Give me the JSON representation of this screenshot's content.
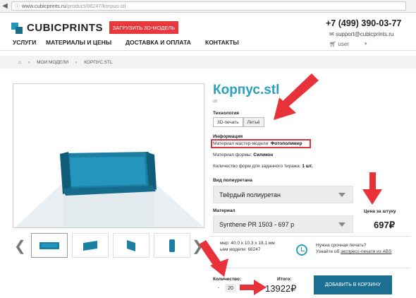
{
  "browser": {
    "url_host": "www.cubicprints.ru",
    "url_path": "/product/68247/korpus-stl"
  },
  "header": {
    "logo_text": "CUBICPRINTS",
    "upload_button": "ЗАГРУЗИТЬ 3D-МОДЕЛЬ",
    "phone": "+7 (499) 390-03-77",
    "email": "support@cubicprints.ru",
    "user": "user",
    "menu": [
      "УСЛУГИ",
      "МАТЕРИАЛЫ И ЦЕНЫ",
      "ДОСТАВКА И ОПЛАТА",
      "КОНТАКТЫ"
    ]
  },
  "breadcrumb": {
    "items": [
      "МОИ МОДЕЛИ",
      "КОРПУС.STL"
    ]
  },
  "product": {
    "title": "Корпус.stl",
    "from": "от",
    "tech_label": "Технология",
    "tech_tabs": [
      "3D-печать",
      "Литьё"
    ],
    "info_label": "Информация",
    "master_material_label": "Материал мастер-модели:",
    "master_material_value": "Фотополимер",
    "form_material_label": "Материал формы:",
    "form_material_value": "Силикон",
    "forms_count_label": "Количество форм для заданного тиража:",
    "forms_count_value": "1 шт.",
    "poly_type_label": "Вид полиуретана",
    "poly_type_value": "Твёрдый полиуретан",
    "material_label": "Материал",
    "material_value": "Synthene PR 1503 - 697 р",
    "unit_price_label": "Цена за штуку",
    "unit_price": "697₽",
    "dims_line1": "мер: 40.0 x 10.3 x 18.1 мм",
    "dims_line2": "ьем модели: 68247",
    "express_line1": "Нужна срочная печать?",
    "express_prefix": "Узнайте об ",
    "express_link": "экспресс-печати из ABS",
    "qty_label": "Количество:",
    "qty_value": "20",
    "qty_minus": "-",
    "qty_plus": "+",
    "total_label": "Итого:",
    "total_value": "13922₽",
    "cart_button": "ДОБАВИТЬ В КОРЗИНУ"
  },
  "colors": {
    "accent": "#2aa0c0",
    "upload_red": "#e8383d",
    "cart_blue": "#1b6f90",
    "annotation_red": "#e8323a",
    "model_blue": "#1a7fa3"
  }
}
